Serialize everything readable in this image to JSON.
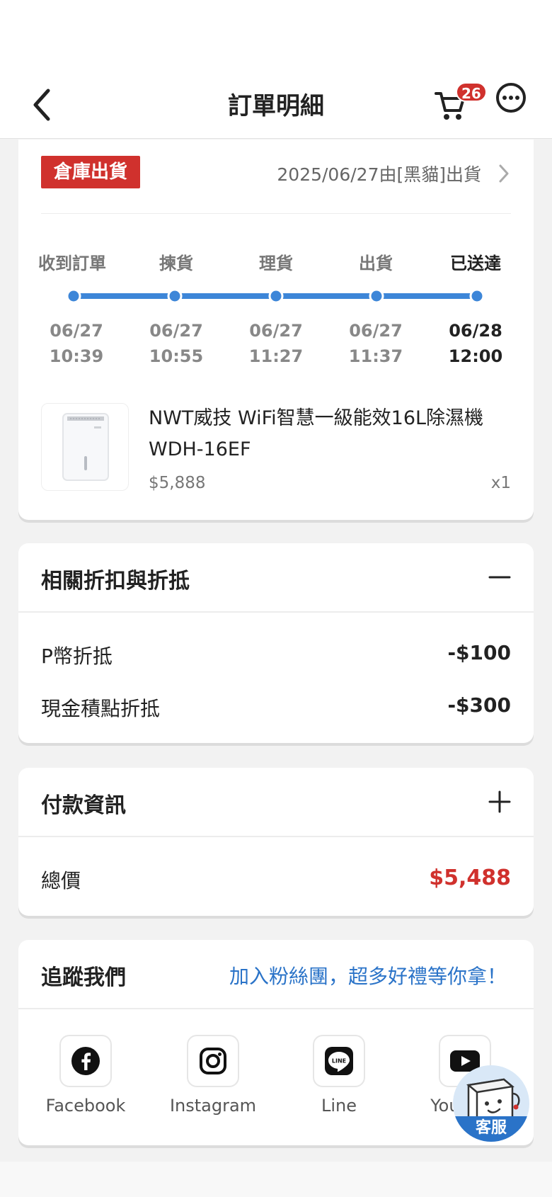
{
  "header": {
    "title": "訂單明細",
    "cart_count": "26"
  },
  "shipment": {
    "tag": "倉庫出貨",
    "info": "2025/06/27由[黑貓]出貨",
    "steps": [
      {
        "label": "收到訂單",
        "date": "06/27",
        "time": "10:39"
      },
      {
        "label": "揀貨",
        "date": "06/27",
        "time": "10:55"
      },
      {
        "label": "理貨",
        "date": "06/27",
        "time": "11:27"
      },
      {
        "label": "出貨",
        "date": "06/27",
        "time": "11:37"
      },
      {
        "label": "已送達",
        "date": "06/28",
        "time": "12:00"
      }
    ],
    "progress_color": "#3d86d8"
  },
  "product": {
    "name": "NWT威技 WiFi智慧一級能效16L除濕機WDH-16EF",
    "price": "$5,888",
    "qty": "x1"
  },
  "discounts": {
    "title": "相關折扣與折抵",
    "rows": [
      {
        "label": "P幣折抵",
        "value": "-$100"
      },
      {
        "label": "現金積點折抵",
        "value": "-$300"
      }
    ]
  },
  "payment": {
    "title": "付款資訊",
    "total_label": "總價",
    "total_value": "$5,488"
  },
  "follow": {
    "title": "追蹤我們",
    "link": "加入粉絲團，超多好禮等你拿！",
    "items": [
      {
        "label": "Facebook",
        "icon": "facebook-icon"
      },
      {
        "label": "Instagram",
        "icon": "instagram-icon"
      },
      {
        "label": "Line",
        "icon": "line-icon"
      },
      {
        "label": "YouTube",
        "icon": "youtube-icon"
      }
    ]
  },
  "customer_service": {
    "label": "客服"
  },
  "colors": {
    "accent_red": "#d0312d",
    "link_blue": "#2a73c8"
  }
}
